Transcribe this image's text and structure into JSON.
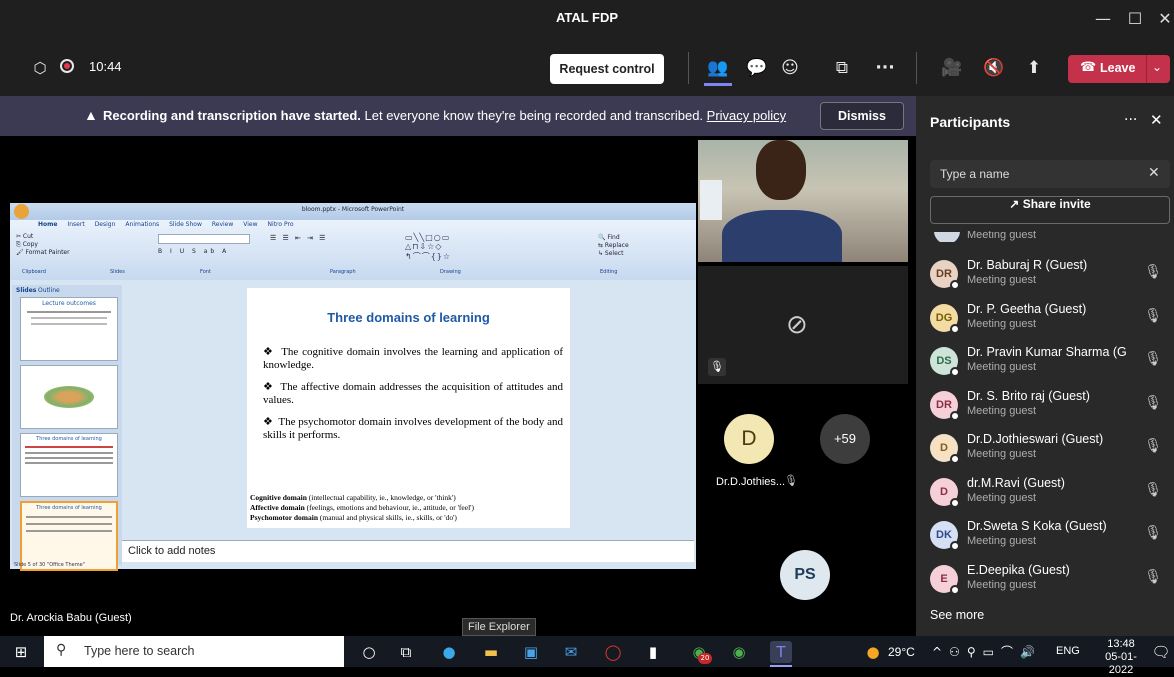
{
  "window": {
    "title": "ATAL FDP"
  },
  "toolbar": {
    "time": "10:44",
    "request_control": "Request control",
    "leave": "Leave"
  },
  "banner": {
    "bold": "Recording and transcription have started.",
    "text": "Let everyone know they're being recorded and transcribed.",
    "link": "Privacy policy",
    "dismiss": "Dismiss"
  },
  "ppt": {
    "title": "bloom.pptx - Microsoft PowerPoint",
    "tabs": [
      "Home",
      "Insert",
      "Design",
      "Animations",
      "Slide Show",
      "Review",
      "View",
      "Nitro Pro"
    ],
    "groups": [
      "Clipboard",
      "Slides",
      "Font",
      "Paragraph",
      "Drawing",
      "Editing"
    ],
    "pane_tabs": [
      "Slides",
      "Outline"
    ],
    "slide": {
      "title": "Three domains of learning",
      "bullets": [
        "The cognitive domain involves the learning and application of knowledge.",
        "The affective domain addresses the acquisition of attitudes and values.",
        "The psychomotor domain involves development of the body and skills it performs."
      ],
      "footer": [
        {
          "b": "Cognitive domain",
          "t": " (intellectual capability, ie., knowledge, or 'think')"
        },
        {
          "b": "Affective domain",
          "t": " (feelings, emotions and behaviour, ie., attitude, or 'feel')"
        },
        {
          "b": "Psychomotor domain",
          "t": " (manual and physical skills, ie., skills, or 'do')"
        }
      ]
    },
    "notes": "Click to add notes",
    "status": "Slide 5 of 30   \"Office Theme\"",
    "thumb1": "Lecture outcomes",
    "thumb3": "Three domains of learning"
  },
  "presenter": "Dr. Arockia Babu (Guest)",
  "tiles": {
    "d_initial": "D",
    "d_name": "Dr.D.Jothies...",
    "more": "+59",
    "ps": "PS"
  },
  "panel": {
    "title": "Participants",
    "search_placeholder": "Type a name",
    "share_invite": "Share invite",
    "partial": "Meeting guest",
    "participants": [
      {
        "initials": "DR",
        "name": "Dr. Baburaj R (Guest)",
        "role": "Meeting guest",
        "color": "#e8d2c4",
        "tcolor": "#6a3b1f"
      },
      {
        "initials": "DG",
        "name": "Dr. P. Geetha (Guest)",
        "role": "Meeting guest",
        "color": "#f3dca4",
        "tcolor": "#7a5b00"
      },
      {
        "initials": "DS",
        "name": "Dr. Pravin Kumar Sharma (Gu...",
        "role": "Meeting guest",
        "color": "#cfe4d8",
        "tcolor": "#2f6b4a"
      },
      {
        "initials": "DR",
        "name": "Dr. S. Brito raj (Guest)",
        "role": "Meeting guest",
        "color": "#f5d0d8",
        "tcolor": "#8a2d45"
      },
      {
        "initials": "D",
        "name": "Dr.D.Jothieswari (Guest)",
        "role": "Meeting guest",
        "color": "#f7e1c4",
        "tcolor": "#8a5a1a"
      },
      {
        "initials": "D",
        "name": "dr.M.Ravi (Guest)",
        "role": "Meeting guest",
        "color": "#f5d0d8",
        "tcolor": "#8a2d45"
      },
      {
        "initials": "DK",
        "name": "Dr.Sweta S Koka (Guest)",
        "role": "Meeting guest",
        "color": "#d6e0f5",
        "tcolor": "#2c4c8c"
      },
      {
        "initials": "E",
        "name": "E.Deepika (Guest)",
        "role": "Meeting guest",
        "color": "#f5d0d8",
        "tcolor": "#8a2d45"
      }
    ],
    "see_more": "See more"
  },
  "tooltip": "File Explorer",
  "taskbar": {
    "search": "Type here to search",
    "temp": "29°C",
    "lang": "ENG",
    "time": "13:48",
    "date": "05-01-2022",
    "badge": "20"
  }
}
